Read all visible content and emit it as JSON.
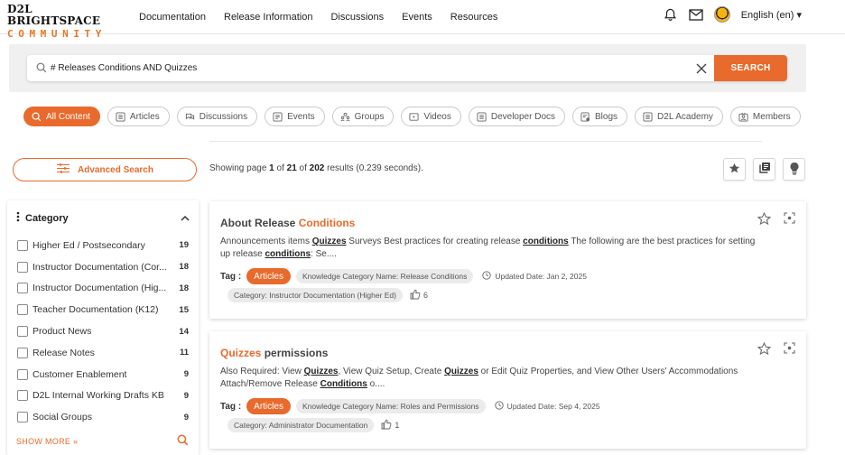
{
  "header": {
    "logo_top": "D2L BRIGHTSPACE",
    "logo_bottom": "COMMUNITY",
    "nav": [
      "Documentation",
      "Release Information",
      "Discussions",
      "Events",
      "Resources"
    ],
    "icons": [
      "bell-icon",
      "mail-icon",
      "avatar"
    ],
    "language": "English (en) ▾"
  },
  "search": {
    "value": "# Releases Conditions AND Quizzes",
    "button": "SEARCH"
  },
  "tabs": [
    {
      "label": "All Content",
      "icon": "search-icon",
      "active": true
    },
    {
      "label": "Articles",
      "icon": "article-icon",
      "active": false
    },
    {
      "label": "Discussions",
      "icon": "discussion-icon",
      "active": false
    },
    {
      "label": "Events",
      "icon": "event-icon",
      "active": false
    },
    {
      "label": "Groups",
      "icon": "group-icon",
      "active": false
    },
    {
      "label": "Videos",
      "icon": "video-icon",
      "active": false
    },
    {
      "label": "Developer Docs",
      "icon": "docs-icon",
      "active": false
    },
    {
      "label": "Blogs",
      "icon": "blog-icon",
      "active": false
    },
    {
      "label": "D2L Academy",
      "icon": "academy-icon",
      "active": false
    },
    {
      "label": "Members",
      "icon": "members-icon",
      "active": false
    }
  ],
  "advanced_search": "Advanced Search",
  "results_info": {
    "prefix": "Showing page ",
    "page": "1",
    "of1": " of ",
    "pages": "21",
    "of2": " of ",
    "total": "202",
    "suffix": " results (0.239 seconds)."
  },
  "sidebar": {
    "title": "Category",
    "items": [
      {
        "label": "Higher Ed / Postsecondary",
        "count": "19"
      },
      {
        "label": "Instructor Documentation (Cor...",
        "count": "18"
      },
      {
        "label": "Instructor Documentation (Hig...",
        "count": "18"
      },
      {
        "label": "Teacher Documentation (K12)",
        "count": "15"
      },
      {
        "label": "Product News",
        "count": "14"
      },
      {
        "label": "Release Notes",
        "count": "11"
      },
      {
        "label": "Customer Enablement",
        "count": "9"
      },
      {
        "label": "D2L Internal Working Drafts KB",
        "count": "9"
      },
      {
        "label": "Social Groups",
        "count": "9"
      }
    ],
    "show_more": "SHOW MORE »"
  },
  "results": [
    {
      "title_plain": "About Release ",
      "title_hl": "Conditions",
      "title_hl_first": false,
      "desc": [
        {
          "t": "Announcements items ",
          "b": false
        },
        {
          "t": "Quizzes",
          "b": true
        },
        {
          "t": " Surveys Best practices for creating release ",
          "b": false
        },
        {
          "t": "conditions",
          "b": true
        },
        {
          "t": " The following are the best practices for setting up release ",
          "b": false
        },
        {
          "t": "conditions",
          "b": true
        },
        {
          "t": ": Se....",
          "b": false
        }
      ],
      "tag_label": "Tag :",
      "tag": "Articles",
      "knowledge": "Knowledge Category Name: Release Conditions",
      "updated": "Updated Date: Jan 2, 2025",
      "category": "Category: Instructor Documentation (Higher Ed)",
      "likes": "6"
    },
    {
      "title_plain": " permissions",
      "title_hl": "Quizzes",
      "title_hl_first": true,
      "desc": [
        {
          "t": "Also Required: View ",
          "b": false
        },
        {
          "t": "Quizzes",
          "b": true
        },
        {
          "t": ", View Quiz Setup, Create ",
          "b": false
        },
        {
          "t": "Quizzes",
          "b": true
        },
        {
          "t": " or Edit Quiz Properties, and View Other Users' Accommodations Attach/Remove Release ",
          "b": false
        },
        {
          "t": "Conditions",
          "b": true
        },
        {
          "t": " o....",
          "b": false
        }
      ],
      "tag_label": "Tag :",
      "tag": "Articles",
      "knowledge": "Knowledge Category Name: Roles and Permissions",
      "updated": "Updated Date: Sep 4, 2025",
      "category": "Category: Administrator Documentation",
      "likes": "1"
    }
  ],
  "colors": {
    "accent": "#e86a2c",
    "chip_bg": "#ebebeb",
    "band_bg": "#f0f0f0"
  }
}
